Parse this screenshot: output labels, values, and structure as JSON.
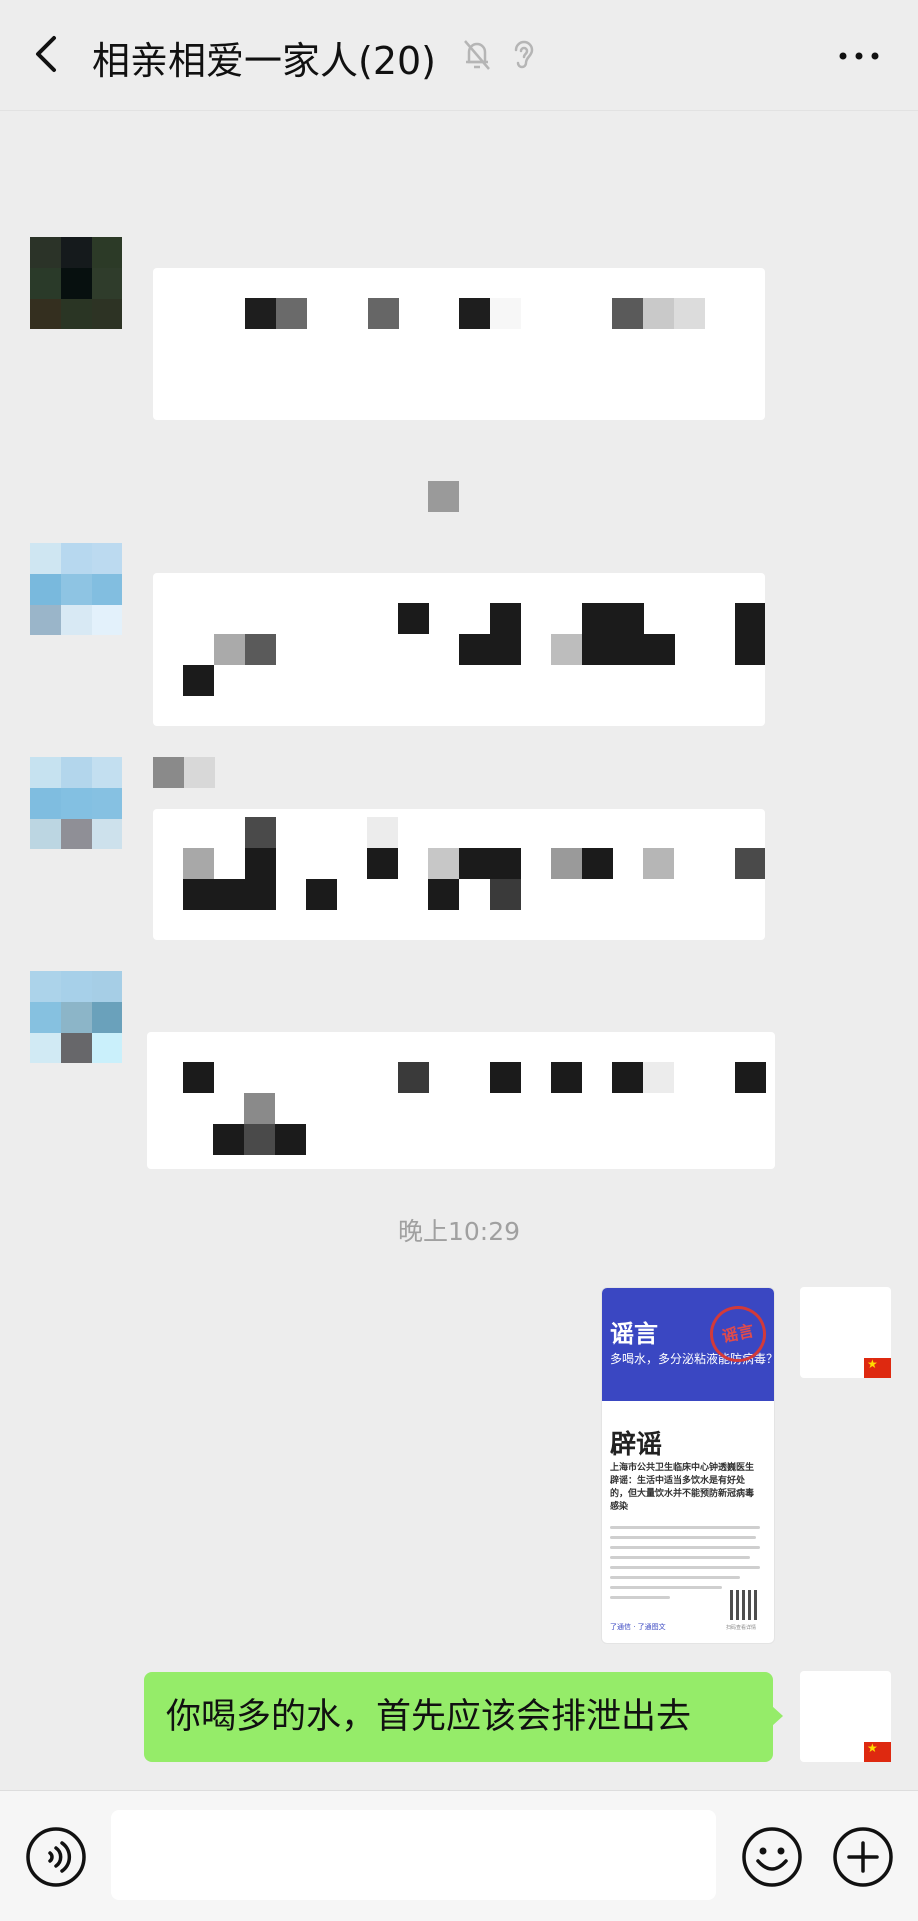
{
  "header": {
    "title": "相亲相爱一家人(20)",
    "back_icon": "chevron-left-icon",
    "mute_icon": "bell-off-icon",
    "ear_icon": "ear-icon",
    "more_icon": "more-dots-icon"
  },
  "messages": {
    "timestamp": "晚上10:29"
  },
  "shared_image": {
    "tag": "谣言",
    "subtitle": "多喝水，多分泌粘液能防病毒？",
    "stamp": "谣言",
    "heading": "辟谣",
    "body": "上海市公共卫生临床中心钟透巍医生辟谣：生活中适当多饮水是有好处的，但大量饮水并不能预防新冠病毒感染",
    "footer": "了通信 · 了通图文",
    "qr_caption": "扫码查看详情"
  },
  "sent_text": {
    "text": "你喝多的水，首先应该会排泄出去"
  },
  "footer": {
    "voice_icon": "voice-icon",
    "emoji_icon": "emoji-icon",
    "plus_icon": "plus-icon"
  },
  "colors": {
    "background": "#ededed",
    "bubble_green": "#95ec69",
    "card_blue": "#3a47c2"
  }
}
